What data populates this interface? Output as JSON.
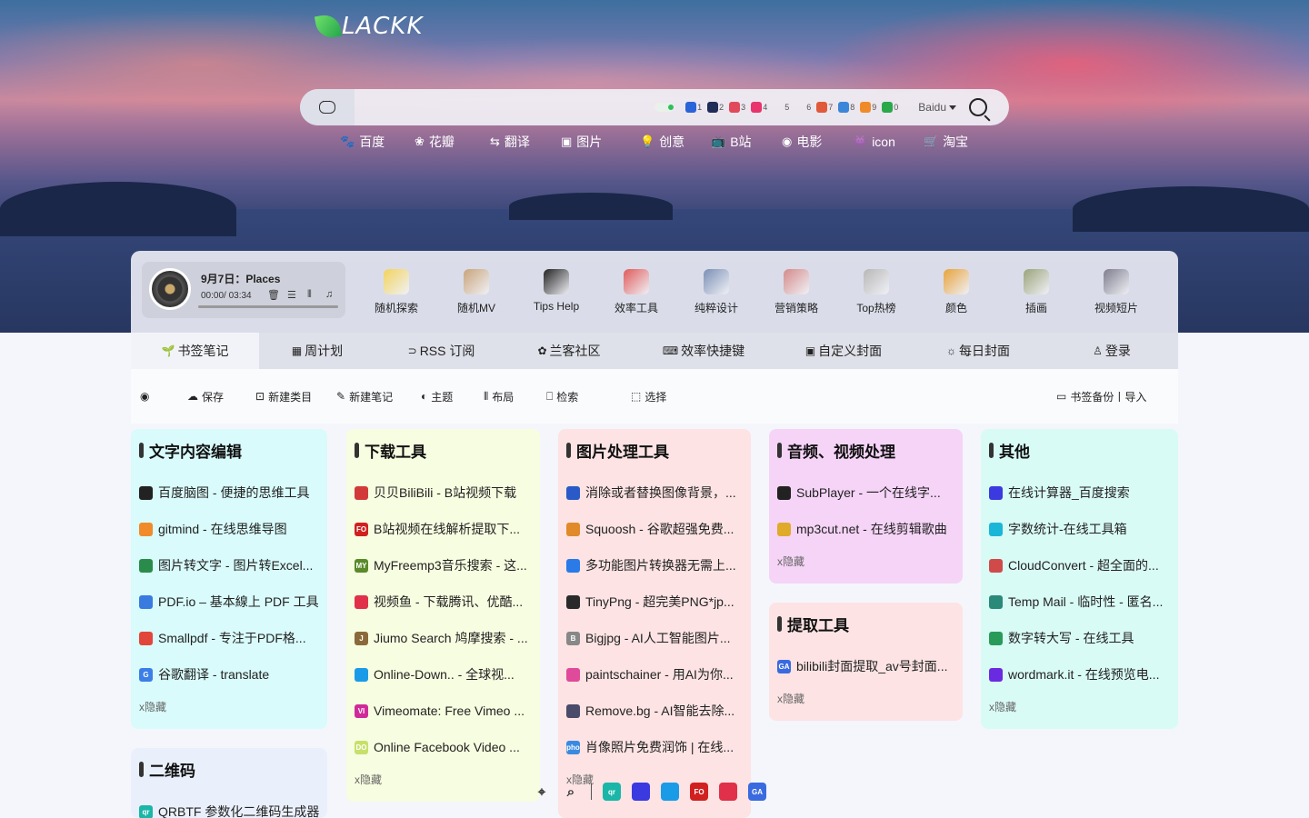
{
  "logo": {
    "text": "LACKK"
  },
  "search": {
    "placeholder": "",
    "engines": [
      {
        "label": "1",
        "color": "#2b64d8",
        "icon": "zhihu-icon"
      },
      {
        "label": "2",
        "color": "#1f2d57",
        "icon": "hex-icon"
      },
      {
        "label": "3",
        "color": "#e14a5a",
        "icon": "red-app-icon"
      },
      {
        "label": "4",
        "color": "#e8336c",
        "icon": "d-icon"
      },
      {
        "label": "5",
        "color": "transparent",
        "icon": "blank-icon"
      },
      {
        "label": "6",
        "color": "transparent",
        "icon": "blank-icon"
      },
      {
        "label": "7",
        "color": "#e05a3a",
        "icon": "vcg-icon"
      },
      {
        "label": "8",
        "color": "#3b86d8",
        "icon": "tv-icon"
      },
      {
        "label": "9",
        "color": "#f08b2a",
        "icon": "s-icon"
      },
      {
        "label": "0",
        "color": "#2aa84a",
        "icon": "box-icon"
      }
    ],
    "engine_selected": "Baidu"
  },
  "quicklinks": [
    {
      "label": "百度",
      "icon": "paw-icon",
      "width": 82
    },
    {
      "label": "花瓣",
      "icon": "petal-icon",
      "width": 83
    },
    {
      "label": "翻译",
      "icon": "translate-icon",
      "width": 78
    },
    {
      "label": "图片",
      "icon": "image-icon",
      "width": 87
    },
    {
      "label": "创意",
      "icon": "bulb-icon",
      "width": 78
    },
    {
      "label": "B站",
      "icon": "tv-icon",
      "width": 78
    },
    {
      "label": "电影",
      "icon": "eye-icon",
      "width": 78
    },
    {
      "label": "icon",
      "icon": "alien-icon",
      "width": 78
    },
    {
      "label": "淘宝",
      "icon": "cart-icon",
      "width": 60
    }
  ],
  "player": {
    "title": "9月7日：Places",
    "time": "00:00/ 03:34",
    "progress": 0.0
  },
  "apps": [
    {
      "label": "随机探索",
      "color": "#f2d35b",
      "icon": "yellow-ring-icon"
    },
    {
      "label": "随机MV",
      "color": "#c9a37a",
      "icon": "video-card-icon"
    },
    {
      "label": "Tips Help",
      "color": "#222222",
      "icon": "tips-icon"
    },
    {
      "label": "效率工具",
      "color": "#e05a5a",
      "icon": "tools-icon"
    },
    {
      "label": "纯粹设计",
      "color": "#7a8fb5",
      "icon": "designer-icon"
    },
    {
      "label": "营销策略",
      "color": "#d48a8a",
      "icon": "marketing-icon"
    },
    {
      "label": "Top热榜",
      "color": "#b7b7b7",
      "icon": "coffee-icon"
    },
    {
      "label": "颜色",
      "color": "#e7a23a",
      "icon": "palette-icon"
    },
    {
      "label": "插画",
      "color": "#9aa37a",
      "icon": "brush-icon"
    },
    {
      "label": "视频短片",
      "color": "#7d7d8d",
      "icon": "camera-icon"
    }
  ],
  "tabs": [
    {
      "label": "书签笔记",
      "icon": "leaf-icon",
      "width": 141,
      "active": true
    },
    {
      "label": "周计划",
      "icon": "calendar-icon",
      "width": 128
    },
    {
      "label": "RSS 订阅",
      "icon": "rss-icon",
      "width": 145
    },
    {
      "label": "兰客社区",
      "icon": "community-icon",
      "width": 136
    },
    {
      "label": "效率快捷键",
      "icon": "keyboard-icon",
      "width": 160
    },
    {
      "label": "自定义封面",
      "icon": "picture-icon",
      "width": 148
    },
    {
      "label": "每日封面",
      "icon": "sun-icon",
      "width": 148
    },
    {
      "label": "登录",
      "icon": "user-icon",
      "width": 146
    }
  ],
  "toolbar": {
    "eye": "",
    "save": "保存",
    "new_category": "新建类目",
    "new_note": "新建笔记",
    "theme": "主题",
    "layout": "布局",
    "search": "检索",
    "select": "选择",
    "backup": "书签备份丨导入"
  },
  "cards": {
    "text": {
      "title": "文字内容编辑",
      "bg": "#d9fbfb",
      "links": [
        {
          "text": "百度脑图 - 便捷的思维工具",
          "color": "#222",
          "badge": ""
        },
        {
          "text": "gitmind - 在线思维导图",
          "color": "#f08a2a",
          "badge": ""
        },
        {
          "text": "图片转文字 - 图片转Excel...",
          "color": "#2a8c4a",
          "badge": ""
        },
        {
          "text": "PDF.io – 基本線上 PDF 工具",
          "color": "#3a7be0",
          "badge": ""
        },
        {
          "text": "Smallpdf - 专注于PDF格...",
          "color": "#e2463a",
          "badge": ""
        },
        {
          "text": "谷歌翻译 - translate",
          "color": "#3b7ee8",
          "badge": "G"
        }
      ],
      "hide": "x隐藏"
    },
    "download": {
      "title": "下载工具",
      "bg": "#f7fde0",
      "links": [
        {
          "text": "贝贝BiliBili - B站视频下载",
          "color": "#d23a3a",
          "badge": ""
        },
        {
          "text": "B站视频在线解析提取下...",
          "color": "#d12020",
          "badge": "FO"
        },
        {
          "text": "MyFreemp3音乐搜索 - 这...",
          "color": "#5a8a2a",
          "badge": "MY"
        },
        {
          "text": "视频鱼 - 下载腾讯、优酷...",
          "color": "#e0304a",
          "badge": ""
        },
        {
          "text": "Jiumo Search 鸠摩搜索 - ...",
          "color": "#8a6a3a",
          "badge": "J"
        },
        {
          "text": "Online-Down.. - 全球视...",
          "color": "#1a9be8",
          "badge": ""
        },
        {
          "text": "Vimeomate: Free Vimeo ...",
          "color": "#d02a9a",
          "badge": "VI"
        },
        {
          "text": "Online Facebook Video ...",
          "color": "#c7e06a",
          "badge": "DO"
        }
      ],
      "hide": "x隐藏"
    },
    "image": {
      "title": "图片处理工具",
      "bg": "#fde3e3",
      "links": [
        {
          "text": "消除或者替换图像背景，...",
          "color": "#2a5ac8",
          "badge": ""
        },
        {
          "text": "Squoosh - 谷歌超强免费...",
          "color": "#e08a2a",
          "badge": ""
        },
        {
          "text": "多功能图片转换器无需上...",
          "color": "#2a7ae8",
          "badge": ""
        },
        {
          "text": "TinyPng - 超完美PNG*jp...",
          "color": "#2a2a2a",
          "badge": ""
        },
        {
          "text": "Bigjpg - AI人工智能图片...",
          "color": "#888888",
          "badge": "B"
        },
        {
          "text": "paintschainer - 用AI为你...",
          "color": "#e04a9a",
          "badge": ""
        },
        {
          "text": "Remove.bg - AI智能去除...",
          "color": "#4a4a6a",
          "badge": ""
        },
        {
          "text": "肖像照片免费润饰 | 在线...",
          "color": "#3a8ae0",
          "badge": "pho"
        }
      ],
      "hide": "x隐藏"
    },
    "audio": {
      "title": "音频、视频处理",
      "bg": "#f5d4f7",
      "links": [
        {
          "text": "SubPlayer - 一个在线字...",
          "color": "#222",
          "badge": ""
        },
        {
          "text": "mp3cut.net - 在线剪辑歌曲",
          "color": "#e0aa2a",
          "badge": ""
        }
      ],
      "hide": "x隐藏"
    },
    "extract": {
      "title": "提取工具",
      "bg": "#fde3e3",
      "links": [
        {
          "text": "bilibili封面提取_av号封面...",
          "color": "#3a6ae0",
          "badge": "GA"
        }
      ],
      "hide": "x隐藏"
    },
    "other": {
      "title": "其他",
      "bg": "#d9fbf6",
      "links": [
        {
          "text": "在线计算器_百度搜索",
          "color": "#3a3ae0",
          "badge": ""
        },
        {
          "text": "字数统计-在线工具箱",
          "color": "#1ab6d8",
          "badge": ""
        },
        {
          "text": "CloudConvert - 超全面的...",
          "color": "#d04a4a",
          "badge": ""
        },
        {
          "text": "Temp Mail - 临时性 - 匿名...",
          "color": "#2a8a7a",
          "badge": ""
        },
        {
          "text": "数字转大写 - 在线工具",
          "color": "#2a9a5a",
          "badge": ""
        },
        {
          "text": "wordmark.it - 在线预览电...",
          "color": "#6a2ae0",
          "badge": ""
        }
      ],
      "hide": "x隐藏"
    },
    "qrcode": {
      "title": "二维码",
      "bg": "#eaf0fb",
      "links": [
        {
          "text": "QRBTF 参数化二维码生成器",
          "color": "#1ab6a8",
          "badge": "qr"
        }
      ]
    }
  },
  "dock": [
    {
      "icon": "crosshair-icon",
      "color": "transparent"
    },
    {
      "icon": "search-icon",
      "color": "transparent"
    },
    {
      "icon": "qr-icon",
      "color": "#1ab6a8",
      "badge": "qr"
    },
    {
      "icon": "paw-icon",
      "color": "#3a3ae0",
      "badge": ""
    },
    {
      "icon": "download-icon",
      "color": "#1a9be8",
      "badge": ""
    },
    {
      "icon": "fo-icon",
      "color": "#d12020",
      "badge": "FO"
    },
    {
      "icon": "play-arrow-icon",
      "color": "#e0304a",
      "badge": ""
    },
    {
      "icon": "ga-icon",
      "color": "#3a6ae0",
      "badge": "GA"
    }
  ]
}
